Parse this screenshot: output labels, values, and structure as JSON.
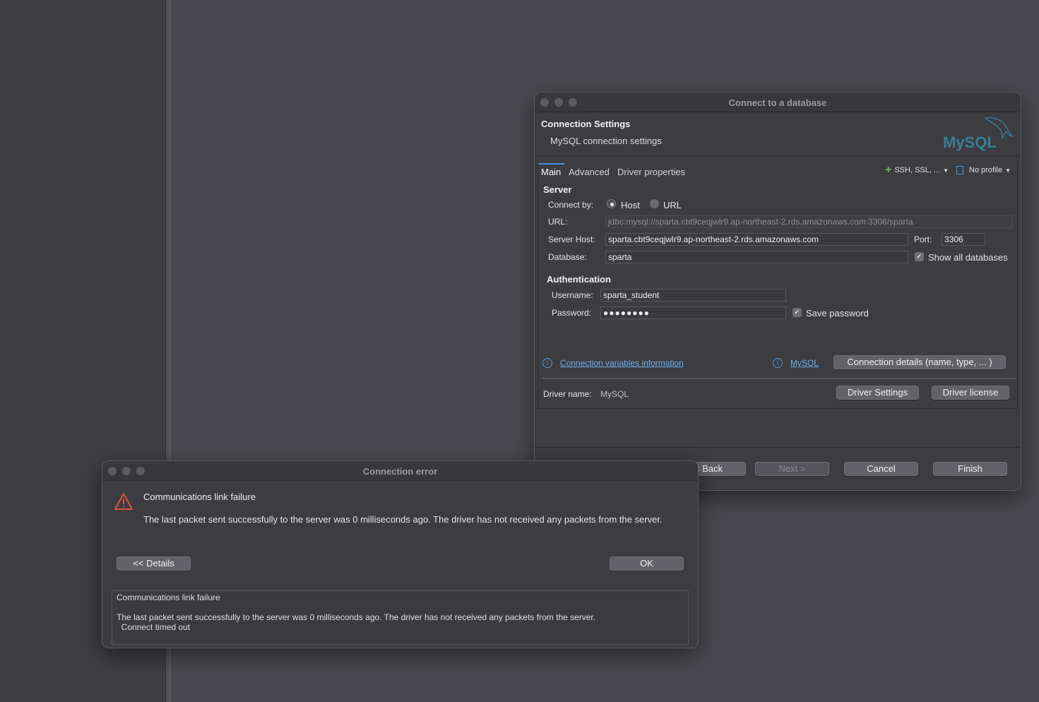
{
  "connect_dialog": {
    "title": "Connect to a database",
    "header_title": "Connection Settings",
    "header_subtitle": "MySQL connection settings",
    "logo_text": "MySQL",
    "tabs": [
      {
        "label": "Main"
      },
      {
        "label": "Advanced"
      },
      {
        "label": "Driver properties"
      }
    ],
    "ssh_menu": "SSH, SSL, ...",
    "profile_menu": "No profile",
    "server_section": "Server",
    "connect_by_label": "Connect by:",
    "connect_by_host": "Host",
    "connect_by_url": "URL",
    "url_label": "URL:",
    "url_value": "jdbc:mysql://sparta.cbt9ceqjwlr9.ap-northeast-2.rds.amazonaws.com:3306/sparta",
    "server_host_label": "Server Host:",
    "server_host_value": "sparta.cbt9ceqjwlr9.ap-northeast-2.rds.amazonaws.com",
    "port_label": "Port:",
    "port_value": "3306",
    "database_label": "Database:",
    "database_value": "sparta",
    "show_all_databases": "Show all databases",
    "auth_section": "Authentication",
    "username_label": "Username:",
    "username_value": "sparta_student",
    "password_label": "Password:",
    "password_value": "●●●●●●●●",
    "save_password": "Save password",
    "conn_vars_link": "Connection variables information",
    "mysql_link": "MySQL",
    "conn_details_button": "Connection details (name, type, ... )",
    "driver_name_label": "Driver name:",
    "driver_name_value": "MySQL",
    "driver_settings_button": "Driver Settings",
    "driver_license_button": "Driver license",
    "back_button": "< Back",
    "next_button": "Next >",
    "cancel_button": "Cancel",
    "finish_button": "Finish"
  },
  "error_dialog": {
    "title": "Connection error",
    "message_title": "Communications link failure",
    "message_body": "The last packet sent successfully to the server was 0 milliseconds ago. The driver has not received any packets from the server.",
    "details_button": "<< Details",
    "ok_button": "OK",
    "details_lines": [
      "Communications link failure",
      "",
      "The last packet sent successfully to the server was 0 milliseconds ago. The driver has not received any packets from the server.",
      "  Connect timed out"
    ]
  },
  "colors": {
    "accent_link": "#6fb0ea",
    "warning": "#d9553b",
    "mysql_blue": "#3a7f99",
    "mysql_orange": "#e48e00"
  }
}
